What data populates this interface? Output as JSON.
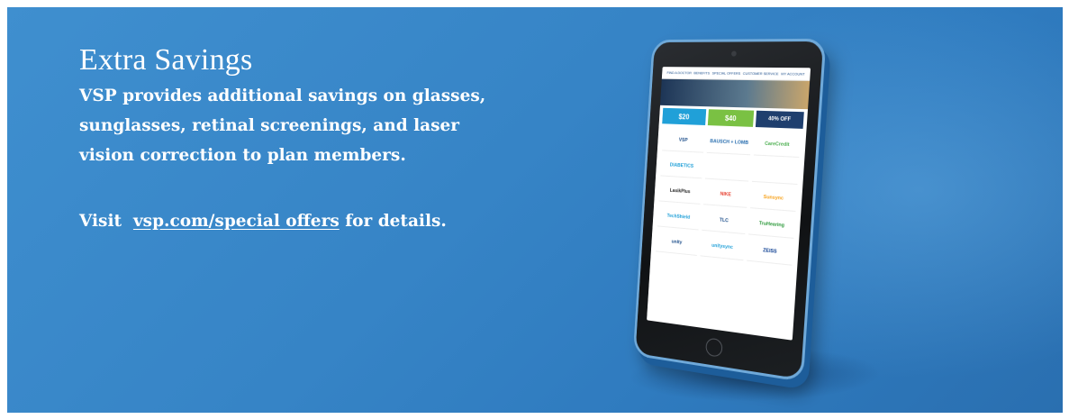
{
  "banner": {
    "heading": "Extra Savings",
    "body_line1": "VSP provides additional savings on glasses,",
    "body_line2": "sunglasses, retinal screenings, and laser",
    "body_line3": "vision correction to plan members.",
    "visit_prefix": "Visit",
    "visit_link": "vsp.com/special offers",
    "visit_suffix": "for details.",
    "colors": {
      "background": "#3684c6",
      "text": "#ffffff"
    }
  },
  "tablet": {
    "nav": [
      "FIND A DOCTOR",
      "BENEFITS",
      "SPECIAL OFFERS",
      "CUSTOMER SERVICE",
      "MY ACCOUNT"
    ],
    "promos": [
      {
        "label": "$20",
        "color": "#20a0d8"
      },
      {
        "label": "$40",
        "color": "#7ac143"
      },
      {
        "label": "40% OFF",
        "color": "#1f3f6e"
      }
    ],
    "partners": [
      {
        "label": "VSP",
        "color": "#1b4d8a"
      },
      {
        "label": "BAUSCH + LOMB",
        "color": "#2a6fb0"
      },
      {
        "label": "CareCredit",
        "color": "#4caf50"
      },
      {
        "label": "DIABETICS",
        "color": "#20a0d8"
      },
      {
        "label": "",
        "color": "#999999"
      },
      {
        "label": "",
        "color": "#999999"
      },
      {
        "label": "LasikPlus",
        "color": "#222222"
      },
      {
        "label": "NIKE",
        "color": "#e7402f"
      },
      {
        "label": "Sunsync",
        "color": "#f7a21b"
      },
      {
        "label": "TechShield",
        "color": "#20a0d8"
      },
      {
        "label": "TLC",
        "color": "#1b4d8a"
      },
      {
        "label": "TruHearing",
        "color": "#2e9a3c"
      },
      {
        "label": "unity",
        "color": "#1b4d8a"
      },
      {
        "label": "unitysync",
        "color": "#20a0d8"
      },
      {
        "label": "ZEISS",
        "color": "#0a3d91"
      }
    ]
  }
}
